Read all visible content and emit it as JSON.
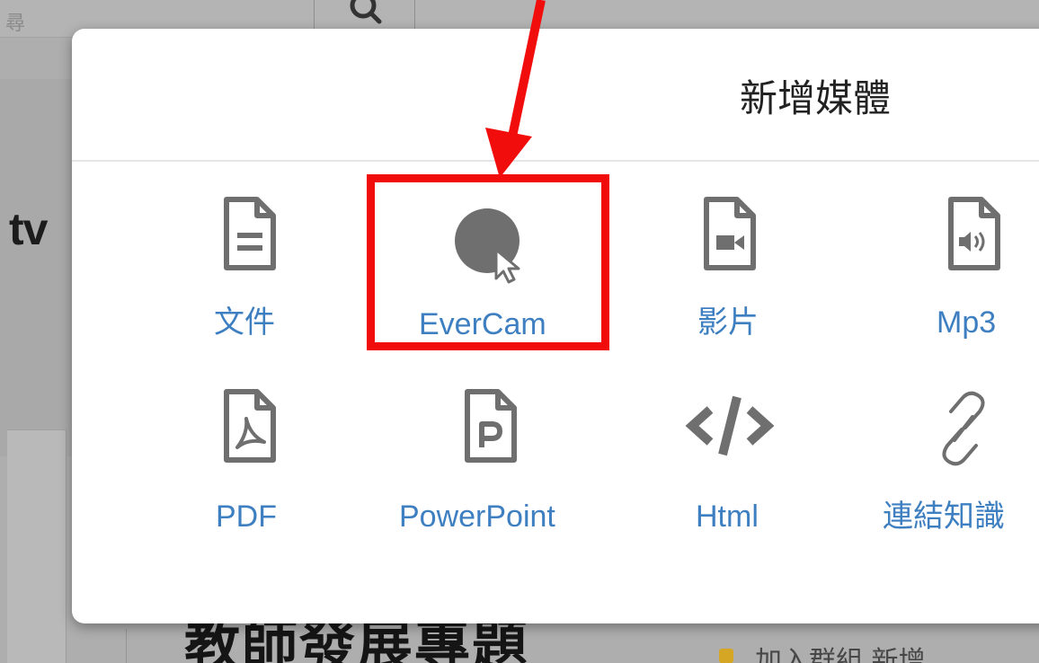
{
  "background": {
    "search_placeholder": "尋",
    "partial_text_tv": "tv",
    "heading_partial": "教師發展專題",
    "links_partial": "加入群組  新增"
  },
  "modal": {
    "title": "新增媒體",
    "items": [
      {
        "label": "文件",
        "icon": "document-icon"
      },
      {
        "label": "EverCam",
        "icon": "evercam-record-icon"
      },
      {
        "label": "影片",
        "icon": "video-file-icon"
      },
      {
        "label": "Mp3",
        "icon": "audio-file-icon"
      },
      {
        "label": "PDF",
        "icon": "pdf-file-icon"
      },
      {
        "label": "PowerPoint",
        "icon": "powerpoint-file-icon"
      },
      {
        "label": "Html",
        "icon": "code-icon"
      },
      {
        "label": "連結知識",
        "icon": "link-icon"
      }
    ]
  },
  "annotation": {
    "highlight_color": "#f20d0d",
    "highlighted_item": "EverCam"
  },
  "colors": {
    "label_blue": "#3e7fc1",
    "icon_gray": "#6f6f6f",
    "backdrop_gray": "#aeaeae"
  }
}
